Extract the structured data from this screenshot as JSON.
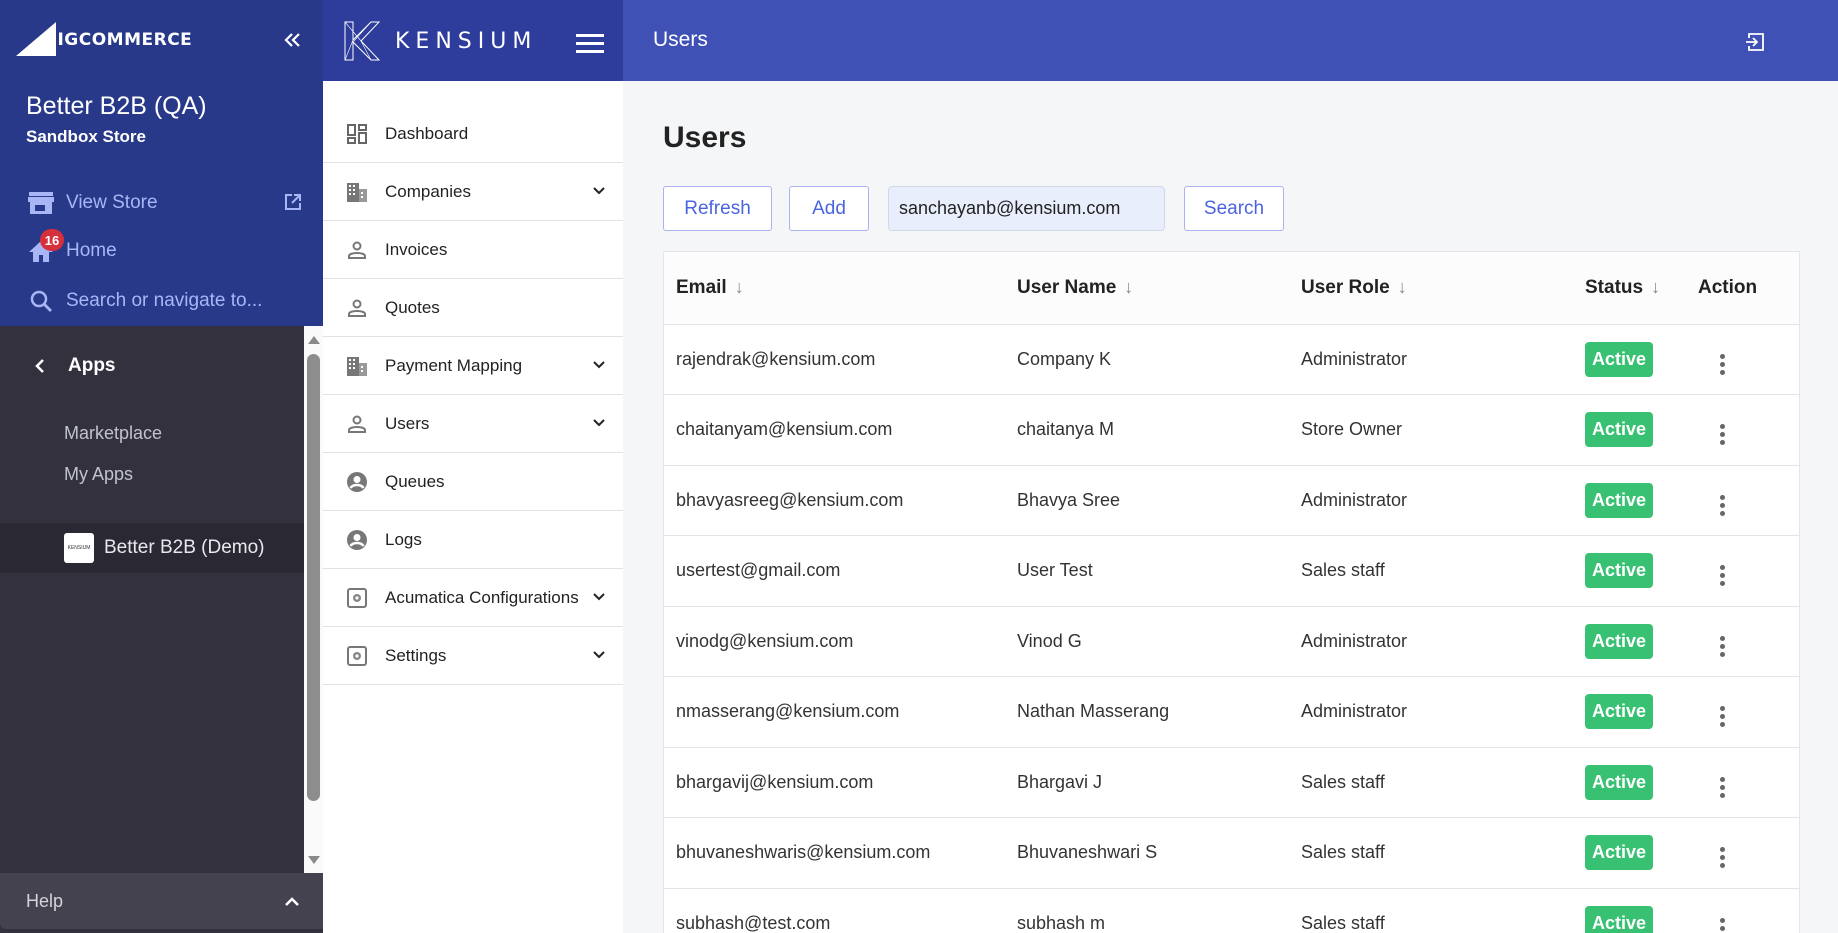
{
  "bigcommerce": {
    "logo_text": "BIGCOMMERCE",
    "store_name": "Better B2B (QA)",
    "store_type": "Sandbox Store",
    "nav": {
      "view_store": "View Store",
      "home": "Home",
      "home_badge": "16",
      "search_placeholder": "Search or navigate to..."
    },
    "apps_section": {
      "title": "Apps",
      "items": [
        "Marketplace",
        "My Apps"
      ],
      "active_app": "Better B2B (Demo)",
      "active_app_logo_text": "KENSIUM"
    },
    "help_label": "Help",
    "colors": {
      "top_bg": "#28398a",
      "dark_bg": "#34313f",
      "badge": "#d6303c"
    }
  },
  "kensium": {
    "logo_text": "KENSIUM",
    "menu": [
      {
        "label": "Dashboard",
        "icon": "dashboard-icon",
        "expandable": false
      },
      {
        "label": "Companies",
        "icon": "building-icon",
        "expandable": true
      },
      {
        "label": "Invoices",
        "icon": "person-outline-icon",
        "expandable": false
      },
      {
        "label": "Quotes",
        "icon": "person-outline-icon",
        "expandable": false
      },
      {
        "label": "Payment Mapping",
        "icon": "building-icon",
        "expandable": true
      },
      {
        "label": "Users",
        "icon": "person-outline-icon",
        "expandable": true
      },
      {
        "label": "Queues",
        "icon": "account-circle-icon",
        "expandable": false
      },
      {
        "label": "Logs",
        "icon": "account-circle-icon",
        "expandable": false
      },
      {
        "label": "Acumatica Configurations",
        "icon": "settings-box-icon",
        "expandable": true
      },
      {
        "label": "Settings",
        "icon": "settings-box-icon",
        "expandable": true
      }
    ]
  },
  "topbar": {
    "title": "Users",
    "color": "#3f51b5"
  },
  "main": {
    "page_title": "Users",
    "toolbar": {
      "refresh_label": "Refresh",
      "add_label": "Add",
      "search_value": "sanchayanb@kensium.com",
      "search_label": "Search"
    },
    "table": {
      "columns": [
        "Email",
        "User Name",
        "User Role",
        "Status",
        "Action"
      ],
      "rows": [
        {
          "email": "rajendrak@kensium.com",
          "name": "Company K",
          "role": "Administrator",
          "status": "Active"
        },
        {
          "email": "chaitanyam@kensium.com",
          "name": "chaitanya M",
          "role": "Store Owner",
          "status": "Active"
        },
        {
          "email": "bhavyasreeg@kensium.com",
          "name": "Bhavya Sree",
          "role": "Administrator",
          "status": "Active"
        },
        {
          "email": "usertest@gmail.com",
          "name": "User Test",
          "role": "Sales staff",
          "status": "Active"
        },
        {
          "email": "vinodg@kensium.com",
          "name": "Vinod G",
          "role": "Administrator",
          "status": "Active"
        },
        {
          "email": "nmasserang@kensium.com",
          "name": "Nathan Masserang",
          "role": "Administrator",
          "status": "Active"
        },
        {
          "email": "bhargavij@kensium.com",
          "name": "Bhargavi J",
          "role": "Sales staff",
          "status": "Active"
        },
        {
          "email": "bhuvaneshwaris@kensium.com",
          "name": "Bhuvaneshwari S",
          "role": "Sales staff",
          "status": "Active"
        },
        {
          "email": "subhash@test.com",
          "name": "subhash m",
          "role": "Sales staff",
          "status": "Active"
        }
      ],
      "status_color": "#38c172"
    }
  }
}
